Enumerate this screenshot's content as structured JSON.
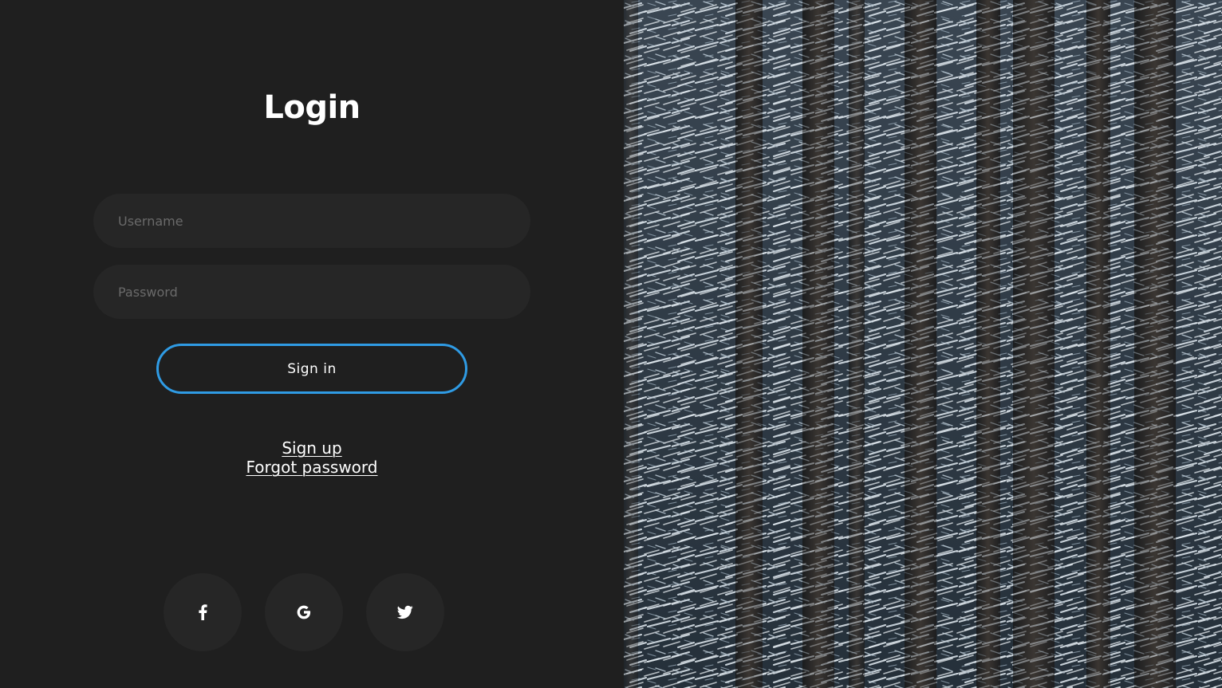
{
  "login": {
    "title": "Login",
    "username_placeholder": "Username",
    "password_placeholder": "Password",
    "sign_in_label": "Sign in",
    "sign_up_link": "Sign up",
    "forgot_password_link": "Forgot password"
  },
  "social": [
    {
      "name": "facebook",
      "icon": "facebook-icon"
    },
    {
      "name": "google",
      "icon": "google-icon"
    },
    {
      "name": "twitter",
      "icon": "twitter-icon"
    }
  ],
  "colors": {
    "background": "#1f1f1f",
    "field_background": "#262626",
    "accent": "#2f9be4",
    "text": "#ffffff",
    "placeholder": "#6a6a6a"
  },
  "image": {
    "subject": "snowy-forest-photo"
  }
}
